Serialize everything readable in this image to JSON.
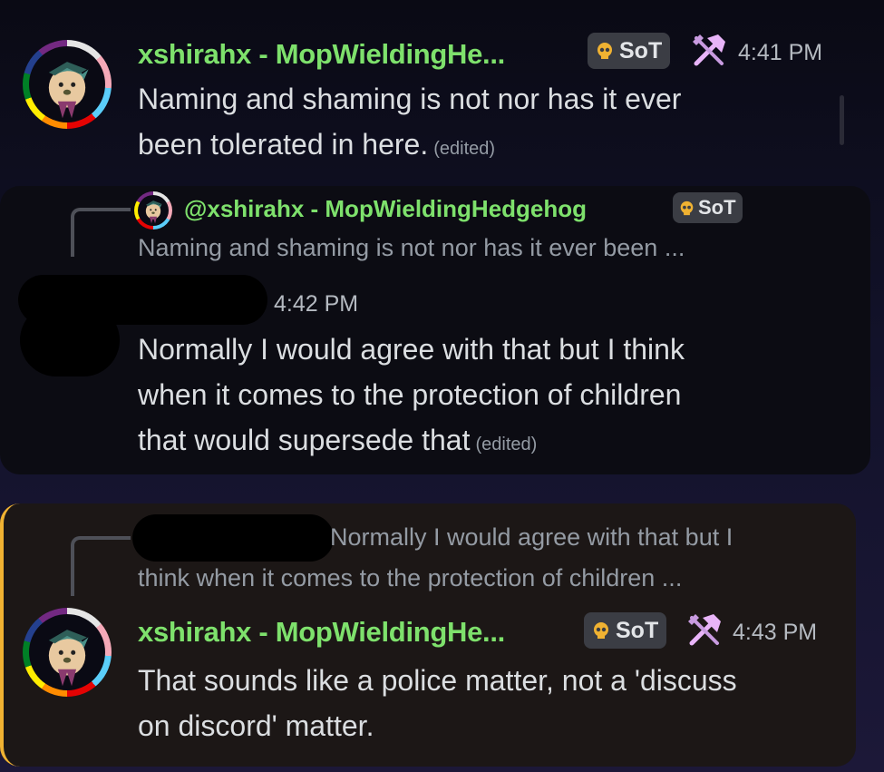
{
  "colors": {
    "username_green": "#7ee16c",
    "badge_bg": "#3b3d44",
    "highlight_border": "#f0b232",
    "muted_text": "#949ba4"
  },
  "messages": [
    {
      "author": "xshirahx - MopWieldingHe...",
      "badge_icon": "skull-icon",
      "badge": "SoT",
      "role_icon": "hammer-icon",
      "time": "4:41 PM",
      "lines": [
        "Naming and shaming is not nor has it ever",
        "been tolerated in here."
      ],
      "edited": "(edited)"
    },
    {
      "reply": {
        "author": "@xshirahx - MopWieldingHedgehog",
        "badge": "SoT",
        "text": "Naming and shaming is not nor has it ever been ..."
      },
      "author": "[redacted]",
      "time": "4:42 PM",
      "lines": [
        "Normally I would agree with that but I think",
        "when it comes to the protection of children",
        "that would supersede that"
      ],
      "edited": "(edited)"
    },
    {
      "reply": {
        "author": "[redacted]",
        "text_line1": "Normally I would agree with that but I",
        "text_line2": "think when it comes to the protection of children ..."
      },
      "author": "xshirahx - MopWieldingHe...",
      "badge": "SoT",
      "time": "4:43 PM",
      "lines": [
        "That sounds like a police matter, not a 'discuss",
        "on discord' matter."
      ]
    }
  ]
}
